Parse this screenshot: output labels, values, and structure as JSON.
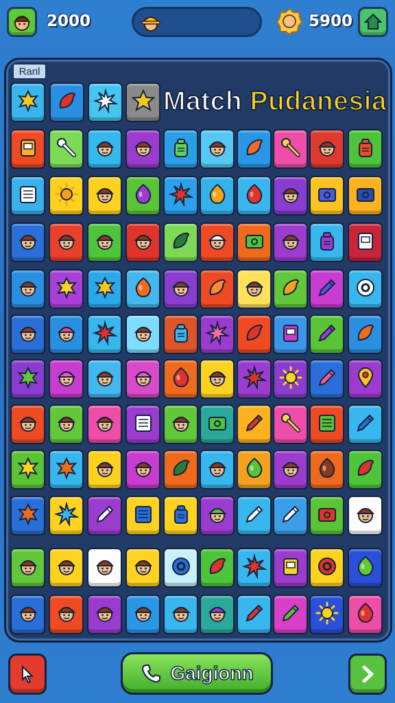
{
  "header": {
    "player_score": "2000",
    "coins": "5900"
  },
  "board": {
    "level_label": "Ranl",
    "title_part1": "Match ",
    "title_part2": "Pudanesia",
    "tiles": [
      {
        "c": "#37b5ec",
        "i": "leaf",
        "f": "#f4c81e"
      },
      {
        "c": "#2a8fe0",
        "i": "chili",
        "f": "#e0342b"
      },
      {
        "c": "#44c6f0",
        "i": "burst",
        "f": "#ffffff"
      },
      {
        "c": "#8a8a8a",
        "i": "star",
        "f": "#f4c81e"
      },
      {
        "c": "#f04a23",
        "i": "card",
        "f": "#ffb02e"
      },
      {
        "c": "#7ed957",
        "i": "key",
        "f": "#ffffff"
      },
      {
        "c": "#35b8ee",
        "i": "face",
        "f": "#8b3a1a"
      },
      {
        "c": "#9b3ccf",
        "i": "face",
        "f": "#8b3a1a"
      },
      {
        "c": "#2a9fe8",
        "i": "jar",
        "f": "#63d05a"
      },
      {
        "c": "#55c8f3",
        "i": "face",
        "f": "#8b3a1a"
      },
      {
        "c": "#2a96e6",
        "i": "chili",
        "f": "#f06a2a"
      },
      {
        "c": "#ee4ea8",
        "i": "key",
        "f": "#ffd24a"
      },
      {
        "c": "#e03a30",
        "i": "face",
        "f": "#8b3a1a"
      },
      {
        "c": "#4ec43a",
        "i": "jar",
        "f": "#f04a23"
      },
      {
        "c": "#3ab0ec",
        "i": "doc",
        "f": "#ffffff"
      },
      {
        "c": "#ffd21f",
        "i": "sun",
        "f": "#f4a21e"
      },
      {
        "c": "#ffd21f",
        "i": "face",
        "f": "#8b3a1a"
      },
      {
        "c": "#5ac436",
        "i": "drop",
        "f": "#9b3ccf"
      },
      {
        "c": "#2aa1ea",
        "i": "burst",
        "f": "#e0342b"
      },
      {
        "c": "#34b2ec",
        "i": "drop",
        "f": "#f4a21e"
      },
      {
        "c": "#3ab6ee",
        "i": "drop",
        "f": "#e0342b"
      },
      {
        "c": "#8a3ccf",
        "i": "face",
        "f": "#8b3a1a"
      },
      {
        "c": "#ffc21f",
        "i": "box",
        "f": "#4a5ad8"
      },
      {
        "c": "#ffb21f",
        "i": "box",
        "f": "#2a4fa8"
      },
      {
        "c": "#2a6fd8",
        "i": "face",
        "f": "#8b3a1a"
      },
      {
        "c": "#e8402a",
        "i": "face",
        "f": "#8b3a1a"
      },
      {
        "c": "#4ec43a",
        "i": "face",
        "f": "#8b3a1a"
      },
      {
        "c": "#e0342b",
        "i": "face",
        "f": "#8b3a1a"
      },
      {
        "c": "#7ed957",
        "i": "chili",
        "f": "#2a7a3a"
      },
      {
        "c": "#f04a23",
        "i": "face",
        "f": "#ffffff"
      },
      {
        "c": "#f06a1e",
        "i": "box",
        "f": "#4ec43a"
      },
      {
        "c": "#9b3ccf",
        "i": "face",
        "f": "#8b3a1a"
      },
      {
        "c": "#38b6ee",
        "i": "jar",
        "f": "#9b3ccf"
      },
      {
        "c": "#c8243a",
        "i": "card",
        "f": "#ffffff"
      },
      {
        "c": "#2a8fe0",
        "i": "face",
        "f": "#8b3a1a"
      },
      {
        "c": "#a840d8",
        "i": "leaf",
        "f": "#ffd21f"
      },
      {
        "c": "#2aa8ea",
        "i": "leaf",
        "f": "#f4c81e"
      },
      {
        "c": "#44b8ee",
        "i": "drop",
        "f": "#f06a1e"
      },
      {
        "c": "#8a3ccf",
        "i": "face",
        "f": "#8b3a1a"
      },
      {
        "c": "#f04a23",
        "i": "chili",
        "f": "#ff8a3a"
      },
      {
        "c": "#ffe15a",
        "i": "face",
        "f": "#8b3a1a"
      },
      {
        "c": "#62c83a",
        "i": "chili",
        "f": "#f4a21e"
      },
      {
        "c": "#c83ccf",
        "i": "pen",
        "f": "#4a5ad8"
      },
      {
        "c": "#3ab6ee",
        "i": "ring",
        "f": "#ffffff"
      },
      {
        "c": "#2a6fd8",
        "i": "face",
        "f": "#8b3a1a"
      },
      {
        "c": "#2a8fe0",
        "i": "face",
        "f": "#e04a8a"
      },
      {
        "c": "#38b6ee",
        "i": "burst",
        "f": "#e0342b"
      },
      {
        "c": "#7edcff",
        "i": "face",
        "f": "#8b3a1a"
      },
      {
        "c": "#e0542a",
        "i": "jar",
        "f": "#3ab6ee"
      },
      {
        "c": "#9b3ccf",
        "i": "burst",
        "f": "#ff6aa8"
      },
      {
        "c": "#f04a23",
        "i": "chili",
        "f": "#e0342b"
      },
      {
        "c": "#3a96e6",
        "i": "card",
        "f": "#c83ccf"
      },
      {
        "c": "#5ac436",
        "i": "pen",
        "f": "#9b3ccf"
      },
      {
        "c": "#2a8fe0",
        "i": "chili",
        "f": "#f06a1e"
      },
      {
        "c": "#8a3ccf",
        "i": "leaf",
        "f": "#62c83a"
      },
      {
        "c": "#c83ccf",
        "i": "face",
        "f": "#e060c8"
      },
      {
        "c": "#44b8ee",
        "i": "face",
        "f": "#8b3a1a"
      },
      {
        "c": "#d84ac8",
        "i": "face",
        "f": "#e060c8"
      },
      {
        "c": "#f06a1e",
        "i": "drop",
        "f": "#e0342b"
      },
      {
        "c": "#ffd21f",
        "i": "face",
        "f": "#8b3a1a"
      },
      {
        "c": "#9b3ccf",
        "i": "burst",
        "f": "#e0342b"
      },
      {
        "c": "#8a3ccf",
        "i": "sun",
        "f": "#ffd21f"
      },
      {
        "c": "#2a6fd8",
        "i": "pen",
        "f": "#ff5a8a"
      },
      {
        "c": "#9b3ccf",
        "i": "pin",
        "f": "#ffc21f"
      },
      {
        "c": "#f04a23",
        "i": "face",
        "f": "#8b3a1a"
      },
      {
        "c": "#62c83a",
        "i": "face",
        "f": "#8b3a1a"
      },
      {
        "c": "#ee4ea8",
        "i": "face",
        "f": "#8b3a1a"
      },
      {
        "c": "#9b3ccf",
        "i": "doc",
        "f": "#ffffff"
      },
      {
        "c": "#62c83a",
        "i": "face",
        "f": "#8b3a1a"
      },
      {
        "c": "#2aa89a",
        "i": "box",
        "f": "#4ec43a"
      },
      {
        "c": "#ffb21f",
        "i": "pen",
        "f": "#e0342b"
      },
      {
        "c": "#ee4ea8",
        "i": "key",
        "f": "#ffd24a"
      },
      {
        "c": "#f04a23",
        "i": "doc",
        "f": "#5ac436"
      },
      {
        "c": "#38b6ee",
        "i": "pen",
        "f": "#2a6fd8"
      },
      {
        "c": "#5ac436",
        "i": "leaf",
        "f": "#ffd21f"
      },
      {
        "c": "#38b6ee",
        "i": "leaf",
        "f": "#f06a1e"
      },
      {
        "c": "#ffd21f",
        "i": "face",
        "f": "#8b3a1a"
      },
      {
        "c": "#c83ccf",
        "i": "face",
        "f": "#8b3a1a"
      },
      {
        "c": "#f06a1e",
        "i": "chili",
        "f": "#2a7a3a"
      },
      {
        "c": "#38b6ee",
        "i": "face",
        "f": "#8b3a1a"
      },
      {
        "c": "#f4a21e",
        "i": "drop",
        "f": "#5ac436"
      },
      {
        "c": "#9b3ccf",
        "i": "face",
        "f": "#8b3a1a"
      },
      {
        "c": "#f06a1e",
        "i": "drop",
        "f": "#8b3a1a"
      },
      {
        "c": "#4ec43a",
        "i": "chili",
        "f": "#e0342b"
      },
      {
        "c": "#2a6fd8",
        "i": "leaf",
        "f": "#f06a1e"
      },
      {
        "c": "#ffd21f",
        "i": "burst",
        "f": "#3ab6ee"
      },
      {
        "c": "#9b3ccf",
        "i": "pen",
        "f": "#ffffff"
      },
      {
        "c": "#ffd21f",
        "i": "doc",
        "f": "#2a6fd8"
      },
      {
        "c": "#ffd21f",
        "i": "jar",
        "f": "#2a6fd8"
      },
      {
        "c": "#9b3ccf",
        "i": "face",
        "f": "#5ac436"
      },
      {
        "c": "#38b6ee",
        "i": "pen",
        "f": "#ffffff"
      },
      {
        "c": "#3a9fe8",
        "i": "pen",
        "f": "#ffffff"
      },
      {
        "c": "#5ac436",
        "i": "box",
        "f": "#e0342b"
      },
      {
        "c": "#ffffff",
        "i": "face",
        "f": "#8b3a1a"
      },
      {
        "c": "#62c83a",
        "i": "face",
        "f": "#8b3a1a"
      },
      {
        "c": "#ffd21f",
        "i": "face",
        "f": "#8b3a1a"
      },
      {
        "c": "#ffffff",
        "i": "face",
        "f": "#8b3a1a"
      },
      {
        "c": "#ffd21f",
        "i": "face",
        "f": "#8b3a1a"
      },
      {
        "c": "#c8f0f8",
        "i": "ring",
        "f": "#2a6fd8"
      },
      {
        "c": "#4ec43a",
        "i": "chili",
        "f": "#e0342b"
      },
      {
        "c": "#38b6ee",
        "i": "burst",
        "f": "#e0342b"
      },
      {
        "c": "#9b3ccf",
        "i": "card",
        "f": "#ffd21f"
      },
      {
        "c": "#ffd21f",
        "i": "ring",
        "f": "#e0342b"
      },
      {
        "c": "#2a4fd8",
        "i": "drop",
        "f": "#62c83a"
      },
      {
        "c": "#2a6fd8",
        "i": "face",
        "f": "#8b3a1a"
      },
      {
        "c": "#f04a23",
        "i": "face",
        "f": "#8b3a1a"
      },
      {
        "c": "#9b3ccf",
        "i": "face",
        "f": "#8b3a1a"
      },
      {
        "c": "#2a96e6",
        "i": "face",
        "f": "#8b3a1a"
      },
      {
        "c": "#38b6ee",
        "i": "face",
        "f": "#8b3a1a"
      },
      {
        "c": "#2aa89a",
        "i": "face",
        "f": "#9b3ccf"
      },
      {
        "c": "#38b6ee",
        "i": "pen",
        "f": "#e0342b"
      },
      {
        "c": "#d840c8",
        "i": "pen",
        "f": "#5ac436"
      },
      {
        "c": "#2a4fd8",
        "i": "sun",
        "f": "#ffd21f"
      },
      {
        "c": "#ee4ea8",
        "i": "drop",
        "f": "#e0342b"
      }
    ]
  },
  "footer": {
    "play_label": "Gaigionn"
  }
}
